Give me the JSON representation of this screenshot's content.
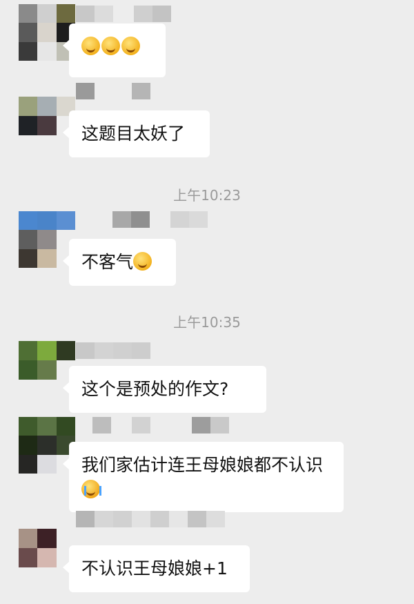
{
  "timestamps": [
    "上午10:23",
    "上午10:35"
  ],
  "messages": [
    {
      "text": "",
      "emojis": [
        "grinning-sweat",
        "grinning-sweat",
        "grinning-sweat"
      ]
    },
    {
      "text": "这题目太妖了",
      "emojis": []
    },
    {
      "text": "不客气",
      "emojis": [
        "grinning-face"
      ]
    },
    {
      "text": "这个是预处的作文?",
      "emojis": []
    },
    {
      "text": "我们家估计连王母娘娘都不认识",
      "emojis": [
        "crying-face"
      ]
    },
    {
      "text": "不认识王母娘娘+1",
      "emojis": []
    }
  ]
}
